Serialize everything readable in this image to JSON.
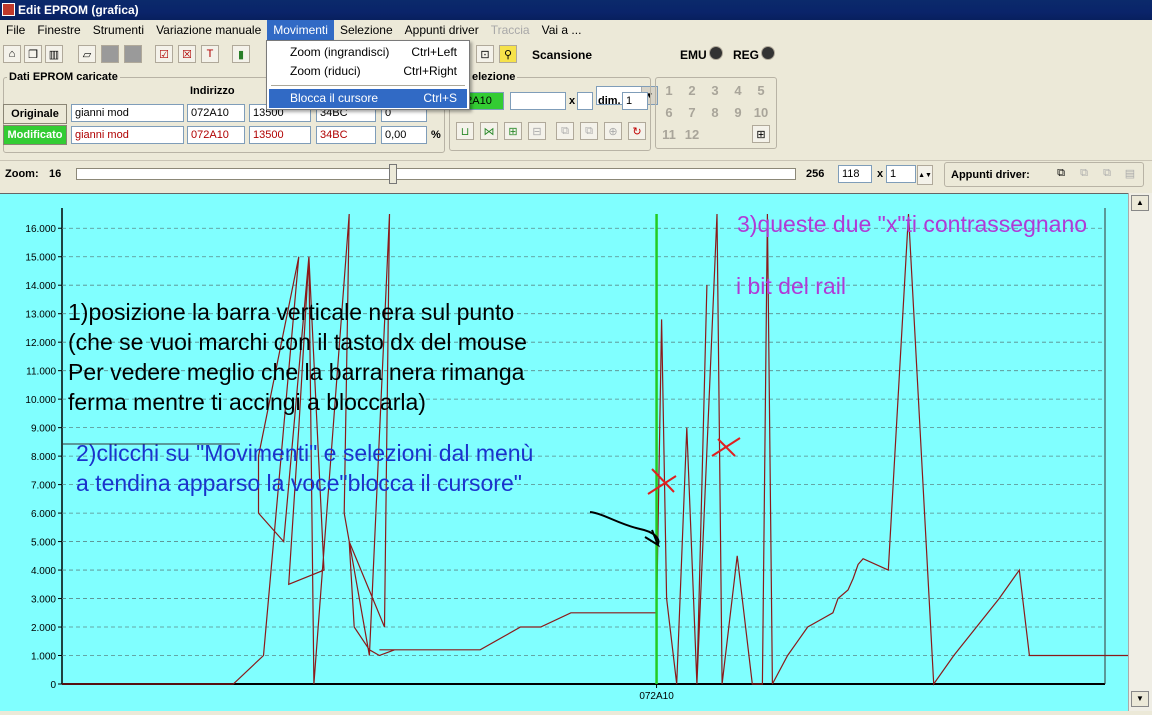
{
  "window": {
    "title": "Edit EPROM (grafica)"
  },
  "menubar": {
    "items": [
      {
        "label": "File"
      },
      {
        "label": "Finestre"
      },
      {
        "label": "Strumenti"
      },
      {
        "label": "Variazione manuale"
      },
      {
        "label": "Movimenti",
        "active": true
      },
      {
        "label": "Selezione"
      },
      {
        "label": "Appunti driver"
      },
      {
        "label": "Traccia",
        "disabled": true
      },
      {
        "label": "Vai a ..."
      }
    ]
  },
  "dropdown": {
    "items": [
      {
        "label": "Zoom (ingrandisci)",
        "shortcut": "Ctrl+Left"
      },
      {
        "label": "Zoom (riduci)",
        "shortcut": "Ctrl+Right"
      },
      {
        "label": "Blocca il cursore",
        "shortcut": "Ctrl+S",
        "selected": true
      }
    ]
  },
  "toolbar": {
    "scansione_label": "Scansione",
    "scansione_value": "",
    "emu_label": "EMU",
    "reg_label": "REG"
  },
  "dati": {
    "title": "Dati EPROM caricate",
    "indirizzo_header": "Indirizzo",
    "originale": {
      "label": "Originale",
      "name": "gianni mod",
      "addr": "072A10",
      "v1": "13500",
      "v2": "34BC",
      "v3": "0"
    },
    "modificato": {
      "label": "Modificato",
      "name": "gianni mod",
      "addr": "072A10",
      "v1": "13500",
      "v2": "34BC",
      "v3": "0,00",
      "unit": "%"
    }
  },
  "selezione": {
    "title": "elezione",
    "addr": "72A10",
    "field2": "",
    "x_label": "x",
    "dim_label": "dim.",
    "dim_value": "1"
  },
  "numgrid": [
    "1",
    "2",
    "3",
    "4",
    "5",
    "6",
    "7",
    "8",
    "9",
    "10",
    "11",
    "12"
  ],
  "zoom": {
    "label": "Zoom:",
    "min": "16",
    "max": "256",
    "value": "118",
    "x_label": "x",
    "mult": "1",
    "position_fraction": 0.44,
    "appunti_label": "Appunti driver:"
  },
  "colors": {
    "chart_bg": "#80ffff",
    "line": "#8b1a1a",
    "cursor": "#22cc22",
    "annotation_black": "#000000",
    "annotation_blue": "#1a33cc",
    "annotation_purple": "#b03ad6",
    "annotation_red": "#e02020"
  },
  "annotations": {
    "note1_lines": [
      "1)posizione la barra verticale nera sul punto",
      "(che se vuoi marchi con il tasto dx del mouse",
      "Per vedere meglio che la barra nera rimanga",
      "ferma mentre ti accingi a bloccarla)"
    ],
    "note2_lines": [
      "2)clicchi su \"Movimenti\" e selezioni dal menù",
      " a tendina apparso la voce\"blocca il cursore\""
    ],
    "note3_lines": [
      "3)queste due \"x\"ti contrassegnano",
      "i bit del rail"
    ]
  },
  "chart_data": {
    "type": "line",
    "title": "",
    "xlabel": "",
    "ylabel": "",
    "ylim": [
      0,
      16500
    ],
    "yticks": [
      "0",
      "1.000",
      "2.000",
      "3.000",
      "4.000",
      "5.000",
      "6.000",
      "7.000",
      "8.000",
      "9.000",
      "10.000",
      "11.000",
      "12.000",
      "13.000",
      "14.000",
      "15.000",
      "16.000"
    ],
    "x_marker_label": "072A10",
    "cursor_x_index": 118,
    "x_range": [
      0,
      207
    ],
    "grid": true,
    "series": [
      {
        "x": [
          0,
          34,
          40,
          47,
          39,
          39,
          44,
          49,
          52,
          45,
          47,
          49,
          50,
          57,
          56,
          61,
          65,
          64,
          57,
          58,
          61,
          63,
          66,
          63,
          70,
          76,
          78,
          81,
          83,
          91,
          95,
          95,
          101,
          106,
          111,
          115,
          116,
          117,
          118,
          119,
          120,
          122,
          124,
          126,
          128,
          126,
          130,
          131,
          134,
          137,
          139,
          140,
          141,
          144,
          146,
          148,
          151,
          153,
          154,
          156,
          157,
          158,
          159,
          164,
          168,
          173,
          177,
          186,
          190,
          192,
          193,
          195,
          196,
          198,
          201,
          203,
          211,
          212
        ],
        "y": [
          0,
          0,
          1000,
          15000,
          8000,
          6000,
          5000,
          15000,
          4000,
          3500,
          9000,
          15000,
          0,
          16500,
          6000,
          1000,
          16500,
          2000,
          5000,
          2000,
          1200,
          1000,
          1200,
          1200,
          1200,
          1200,
          1200,
          1200,
          1200,
          2000,
          2000,
          2000,
          2500,
          2500,
          2500,
          2500,
          2500,
          2500,
          2500,
          12800,
          3000,
          0,
          9000,
          0,
          14000,
          0,
          16500,
          0,
          4500,
          0,
          0,
          16500,
          0,
          1000,
          1500,
          2000,
          2300,
          2500,
          3000,
          3300,
          3700,
          4200,
          4400,
          4000,
          16500,
          0,
          1000,
          3000,
          4000,
          1000,
          1000,
          1000,
          1000,
          1000,
          1000,
          1000,
          1000,
          1000
        ]
      }
    ]
  }
}
